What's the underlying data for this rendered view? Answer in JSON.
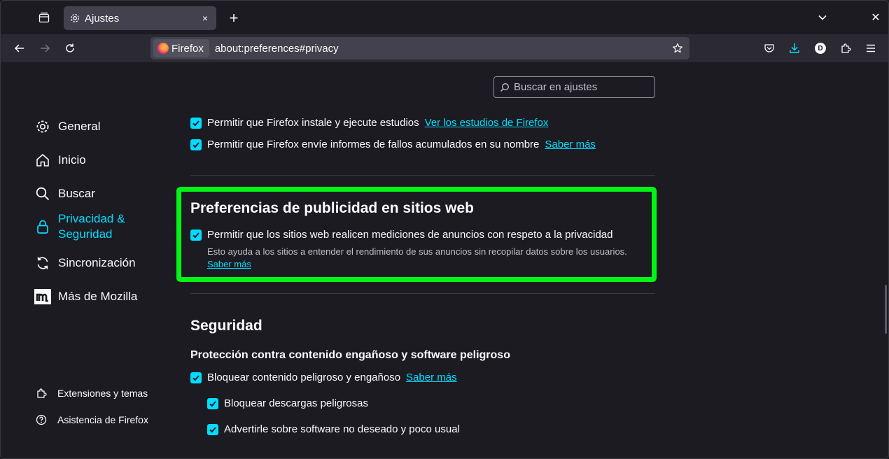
{
  "tab": {
    "title": "Ajustes",
    "close": "×"
  },
  "toolbar": {
    "new_tab": "+",
    "window_close": "✕"
  },
  "urlbar": {
    "identity_label": "Firefox",
    "url": "about:preferences#privacy"
  },
  "account": {
    "initial": "D"
  },
  "search": {
    "placeholder": "Buscar en ajustes"
  },
  "sidebar": {
    "items": [
      {
        "label": "General"
      },
      {
        "label": "Inicio"
      },
      {
        "label": "Buscar"
      },
      {
        "label": "Privacidad &",
        "label2": "Seguridad"
      },
      {
        "label": "Sincronización"
      },
      {
        "label": "Más de Mozilla"
      }
    ],
    "footer": [
      {
        "label": "Extensiones y temas"
      },
      {
        "label": "Asistencia de Firefox"
      }
    ]
  },
  "data_collection": {
    "studies_label": "Permitir que Firefox instale y ejecute estudios",
    "studies_link": "Ver los estudios de Firefox",
    "crash_label": "Permitir que Firefox envíe informes de fallos acumulados en su nombre",
    "crash_link": "Saber más"
  },
  "ads": {
    "heading": "Preferencias de publicidad en sitios web",
    "checkbox_label": "Permitir que los sitios web realicen mediciones de anuncios con respeto a la privacidad",
    "description": "Esto ayuda a los sitios a entender el rendimiento de sus anuncios sin recopilar datos sobre los usuarios.",
    "link": "Saber más"
  },
  "security": {
    "heading": "Seguridad",
    "subheading": "Protección contra contenido engañoso y software peligroso",
    "block_dangerous": "Bloquear contenido peligroso y engañoso",
    "block_dangerous_link": "Saber más",
    "block_downloads": "Bloquear descargas peligrosas",
    "warn_unwanted": "Advertirle sobre software no deseado y poco usual"
  },
  "colors": {
    "accent": "#00ddff",
    "highlight": "#00f514",
    "background": "#1c1b22",
    "toolbar": "#2b2a33"
  }
}
